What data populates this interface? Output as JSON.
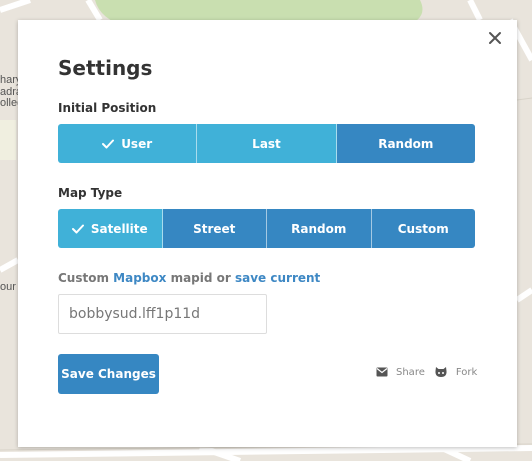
{
  "map": {
    "labels": [
      "hary",
      "adra",
      "olleg"
    ],
    "label_bottom": "our"
  },
  "modal": {
    "title": "Settings",
    "close_icon": "close-icon",
    "initial_position": {
      "label": "Initial Position",
      "options": [
        "User",
        "Last",
        "Random"
      ],
      "selected": "User"
    },
    "map_type": {
      "label": "Map Type",
      "options": [
        "Satellite",
        "Street",
        "Random",
        "Custom"
      ],
      "selected": "Satellite"
    },
    "custom": {
      "prefix": "Custom",
      "mapbox_link": "Mapbox",
      "middle": "mapid or",
      "save_current_link": "save current",
      "input_value": "bobbysud.lff1p11d"
    },
    "save_button": "Save Changes",
    "share_label": "Share",
    "fork_label": "Fork"
  },
  "colors": {
    "accent_light": "#40b1d8",
    "accent_dark": "#3687c2",
    "link": "#3e88c4",
    "map_bg": "#e9e4dc"
  }
}
